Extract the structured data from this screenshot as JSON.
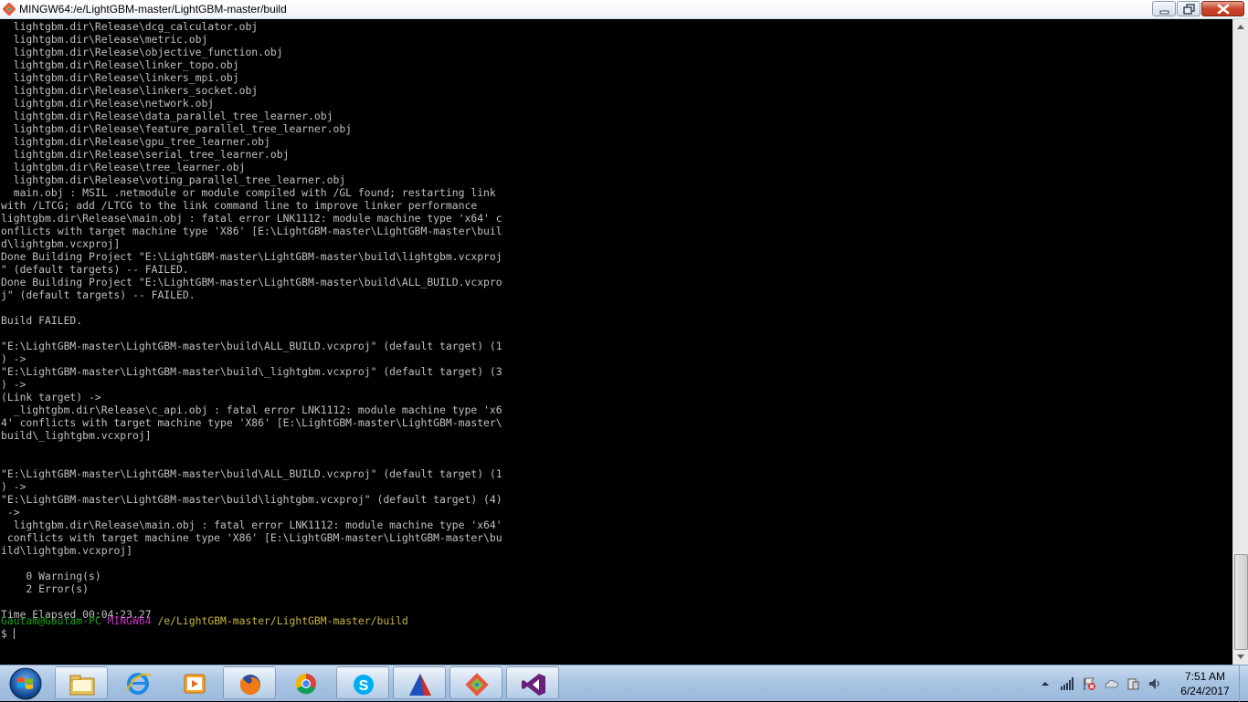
{
  "window": {
    "title": "MINGW64:/e/LightGBM-master/LightGBM-master/build",
    "icon": "git-bash-icon"
  },
  "terminal": {
    "lines": [
      "  lightgbm.dir\\Release\\dcg_calculator.obj",
      "  lightgbm.dir\\Release\\metric.obj",
      "  lightgbm.dir\\Release\\objective_function.obj",
      "  lightgbm.dir\\Release\\linker_topo.obj",
      "  lightgbm.dir\\Release\\linkers_mpi.obj",
      "  lightgbm.dir\\Release\\linkers_socket.obj",
      "  lightgbm.dir\\Release\\network.obj",
      "  lightgbm.dir\\Release\\data_parallel_tree_learner.obj",
      "  lightgbm.dir\\Release\\feature_parallel_tree_learner.obj",
      "  lightgbm.dir\\Release\\gpu_tree_learner.obj",
      "  lightgbm.dir\\Release\\serial_tree_learner.obj",
      "  lightgbm.dir\\Release\\tree_learner.obj",
      "  lightgbm.dir\\Release\\voting_parallel_tree_learner.obj",
      "  main.obj : MSIL .netmodule or module compiled with /GL found; restarting link",
      "with /LTCG; add /LTCG to the link command line to improve linker performance",
      "lightgbm.dir\\Release\\main.obj : fatal error LNK1112: module machine type 'x64' c",
      "onflicts with target machine type 'X86' [E:\\LightGBM-master\\LightGBM-master\\buil",
      "d\\lightgbm.vcxproj]",
      "Done Building Project \"E:\\LightGBM-master\\LightGBM-master\\build\\lightgbm.vcxproj",
      "\" (default targets) -- FAILED.",
      "Done Building Project \"E:\\LightGBM-master\\LightGBM-master\\build\\ALL_BUILD.vcxpro",
      "j\" (default targets) -- FAILED.",
      "",
      "Build FAILED.",
      "",
      "\"E:\\LightGBM-master\\LightGBM-master\\build\\ALL_BUILD.vcxproj\" (default target) (1",
      ") ->",
      "\"E:\\LightGBM-master\\LightGBM-master\\build\\_lightgbm.vcxproj\" (default target) (3",
      ") ->",
      "(Link target) ->",
      "  _lightgbm.dir\\Release\\c_api.obj : fatal error LNK1112: module machine type 'x6",
      "4' conflicts with target machine type 'X86' [E:\\LightGBM-master\\LightGBM-master\\",
      "build\\_lightgbm.vcxproj]",
      "",
      "",
      "\"E:\\LightGBM-master\\LightGBM-master\\build\\ALL_BUILD.vcxproj\" (default target) (1",
      ") ->",
      "\"E:\\LightGBM-master\\LightGBM-master\\build\\lightgbm.vcxproj\" (default target) (4)",
      " ->",
      "  lightgbm.dir\\Release\\main.obj : fatal error LNK1112: module machine type 'x64'",
      " conflicts with target machine type 'X86' [E:\\LightGBM-master\\LightGBM-master\\bu",
      "ild\\lightgbm.vcxproj]",
      "",
      "    0 Warning(s)",
      "    2 Error(s)",
      "",
      "Time Elapsed 00:04:23.27",
      ""
    ],
    "prompt": {
      "user_host": "Gautam@Gautam-PC",
      "shell": "MINGW64",
      "path": "/e/LightGBM-master/LightGBM-master/build",
      "symbol": "$ "
    },
    "colors": {
      "text": "#c0c0c0",
      "user": "#1aa31a",
      "shell": "#c030c0",
      "path": "#c8b440"
    }
  },
  "taskbar": {
    "items": [
      {
        "name": "file-explorer",
        "icon": "folder-icon",
        "active": true
      },
      {
        "name": "internet-explorer",
        "icon": "ie-icon",
        "active": false
      },
      {
        "name": "media-player",
        "icon": "media-player-icon",
        "active": false
      },
      {
        "name": "firefox",
        "icon": "firefox-icon",
        "active": true
      },
      {
        "name": "chrome",
        "icon": "chrome-icon",
        "active": false
      },
      {
        "name": "skype",
        "icon": "skype-icon",
        "active": true
      },
      {
        "name": "cmake-gui",
        "icon": "cmake-icon",
        "active": true
      },
      {
        "name": "git-bash",
        "icon": "git-icon",
        "active": true
      },
      {
        "name": "visual-studio",
        "icon": "visual-studio-icon",
        "active": true
      }
    ],
    "tray_icons": [
      "show-hidden-icons",
      "network-icon",
      "security-flag-icon",
      "onedrive-icon",
      "device-icon",
      "volume-icon"
    ],
    "clock": {
      "time": "7:51 AM",
      "date": "6/24/2017"
    }
  }
}
